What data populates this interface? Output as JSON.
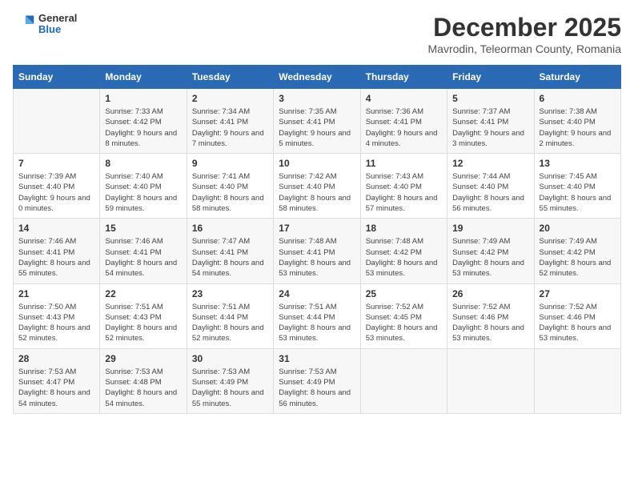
{
  "logo": {
    "general": "General",
    "blue": "Blue"
  },
  "title": "December 2025",
  "location": "Mavrodin, Teleorman County, Romania",
  "days_of_week": [
    "Sunday",
    "Monday",
    "Tuesday",
    "Wednesday",
    "Thursday",
    "Friday",
    "Saturday"
  ],
  "weeks": [
    [
      {
        "day": "",
        "sunrise": "",
        "sunset": "",
        "daylight": ""
      },
      {
        "day": "1",
        "sunrise": "7:33 AM",
        "sunset": "4:42 PM",
        "daylight": "9 hours and 8 minutes."
      },
      {
        "day": "2",
        "sunrise": "7:34 AM",
        "sunset": "4:41 PM",
        "daylight": "9 hours and 7 minutes."
      },
      {
        "day": "3",
        "sunrise": "7:35 AM",
        "sunset": "4:41 PM",
        "daylight": "9 hours and 5 minutes."
      },
      {
        "day": "4",
        "sunrise": "7:36 AM",
        "sunset": "4:41 PM",
        "daylight": "9 hours and 4 minutes."
      },
      {
        "day": "5",
        "sunrise": "7:37 AM",
        "sunset": "4:41 PM",
        "daylight": "9 hours and 3 minutes."
      },
      {
        "day": "6",
        "sunrise": "7:38 AM",
        "sunset": "4:40 PM",
        "daylight": "9 hours and 2 minutes."
      }
    ],
    [
      {
        "day": "7",
        "sunrise": "7:39 AM",
        "sunset": "4:40 PM",
        "daylight": "9 hours and 0 minutes."
      },
      {
        "day": "8",
        "sunrise": "7:40 AM",
        "sunset": "4:40 PM",
        "daylight": "8 hours and 59 minutes."
      },
      {
        "day": "9",
        "sunrise": "7:41 AM",
        "sunset": "4:40 PM",
        "daylight": "8 hours and 58 minutes."
      },
      {
        "day": "10",
        "sunrise": "7:42 AM",
        "sunset": "4:40 PM",
        "daylight": "8 hours and 58 minutes."
      },
      {
        "day": "11",
        "sunrise": "7:43 AM",
        "sunset": "4:40 PM",
        "daylight": "8 hours and 57 minutes."
      },
      {
        "day": "12",
        "sunrise": "7:44 AM",
        "sunset": "4:40 PM",
        "daylight": "8 hours and 56 minutes."
      },
      {
        "day": "13",
        "sunrise": "7:45 AM",
        "sunset": "4:40 PM",
        "daylight": "8 hours and 55 minutes."
      }
    ],
    [
      {
        "day": "14",
        "sunrise": "7:46 AM",
        "sunset": "4:41 PM",
        "daylight": "8 hours and 55 minutes."
      },
      {
        "day": "15",
        "sunrise": "7:46 AM",
        "sunset": "4:41 PM",
        "daylight": "8 hours and 54 minutes."
      },
      {
        "day": "16",
        "sunrise": "7:47 AM",
        "sunset": "4:41 PM",
        "daylight": "8 hours and 54 minutes."
      },
      {
        "day": "17",
        "sunrise": "7:48 AM",
        "sunset": "4:41 PM",
        "daylight": "8 hours and 53 minutes."
      },
      {
        "day": "18",
        "sunrise": "7:48 AM",
        "sunset": "4:42 PM",
        "daylight": "8 hours and 53 minutes."
      },
      {
        "day": "19",
        "sunrise": "7:49 AM",
        "sunset": "4:42 PM",
        "daylight": "8 hours and 53 minutes."
      },
      {
        "day": "20",
        "sunrise": "7:49 AM",
        "sunset": "4:42 PM",
        "daylight": "8 hours and 52 minutes."
      }
    ],
    [
      {
        "day": "21",
        "sunrise": "7:50 AM",
        "sunset": "4:43 PM",
        "daylight": "8 hours and 52 minutes."
      },
      {
        "day": "22",
        "sunrise": "7:51 AM",
        "sunset": "4:43 PM",
        "daylight": "8 hours and 52 minutes."
      },
      {
        "day": "23",
        "sunrise": "7:51 AM",
        "sunset": "4:44 PM",
        "daylight": "8 hours and 52 minutes."
      },
      {
        "day": "24",
        "sunrise": "7:51 AM",
        "sunset": "4:44 PM",
        "daylight": "8 hours and 53 minutes."
      },
      {
        "day": "25",
        "sunrise": "7:52 AM",
        "sunset": "4:45 PM",
        "daylight": "8 hours and 53 minutes."
      },
      {
        "day": "26",
        "sunrise": "7:52 AM",
        "sunset": "4:46 PM",
        "daylight": "8 hours and 53 minutes."
      },
      {
        "day": "27",
        "sunrise": "7:52 AM",
        "sunset": "4:46 PM",
        "daylight": "8 hours and 53 minutes."
      }
    ],
    [
      {
        "day": "28",
        "sunrise": "7:53 AM",
        "sunset": "4:47 PM",
        "daylight": "8 hours and 54 minutes."
      },
      {
        "day": "29",
        "sunrise": "7:53 AM",
        "sunset": "4:48 PM",
        "daylight": "8 hours and 54 minutes."
      },
      {
        "day": "30",
        "sunrise": "7:53 AM",
        "sunset": "4:49 PM",
        "daylight": "8 hours and 55 minutes."
      },
      {
        "day": "31",
        "sunrise": "7:53 AM",
        "sunset": "4:49 PM",
        "daylight": "8 hours and 56 minutes."
      },
      {
        "day": "",
        "sunrise": "",
        "sunset": "",
        "daylight": ""
      },
      {
        "day": "",
        "sunrise": "",
        "sunset": "",
        "daylight": ""
      },
      {
        "day": "",
        "sunrise": "",
        "sunset": "",
        "daylight": ""
      }
    ]
  ],
  "labels": {
    "sunrise_prefix": "Sunrise: ",
    "sunset_prefix": "Sunset: ",
    "daylight_prefix": "Daylight: "
  }
}
